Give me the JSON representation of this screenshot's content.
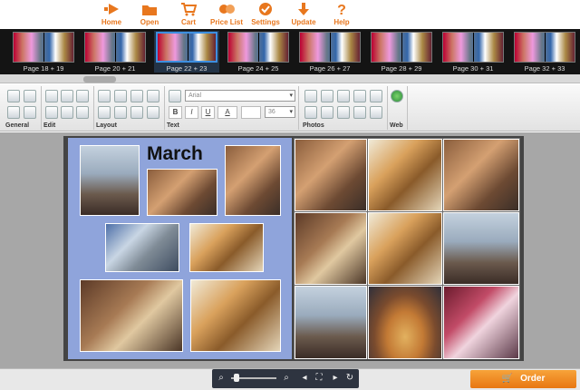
{
  "toolbar": {
    "items": [
      {
        "label": "Home",
        "icon": "arrow-right-icon"
      },
      {
        "label": "Open",
        "icon": "folder-icon"
      },
      {
        "label": "Cart",
        "icon": "cart-icon"
      },
      {
        "label": "Price List",
        "icon": "price-list-icon"
      },
      {
        "label": "Settings",
        "icon": "settings-icon"
      },
      {
        "label": "Update",
        "icon": "download-arrow-icon"
      },
      {
        "label": "Help",
        "icon": "question-icon"
      }
    ],
    "accent": "#e8771e"
  },
  "pages": [
    {
      "label": "Page 18 + 19",
      "selected": false
    },
    {
      "label": "Page 20 + 21",
      "selected": false
    },
    {
      "label": "Page 22 + 23",
      "selected": true
    },
    {
      "label": "Page 24 + 25",
      "selected": false
    },
    {
      "label": "Page 26 + 27",
      "selected": false
    },
    {
      "label": "Page 28 + 29",
      "selected": false
    },
    {
      "label": "Page 30 + 31",
      "selected": false
    },
    {
      "label": "Page 32 + 33",
      "selected": false
    }
  ],
  "ribbon": {
    "groups": [
      "General",
      "Edit",
      "Layout",
      "Text",
      "Photos",
      "Web"
    ],
    "font_name": "Arial",
    "font_size": "36",
    "format_buttons": [
      "B",
      "I",
      "U",
      "A"
    ]
  },
  "page_content": {
    "title_text": "March"
  },
  "bottom": {
    "order_label": "Order",
    "order_color": "#e87712"
  }
}
